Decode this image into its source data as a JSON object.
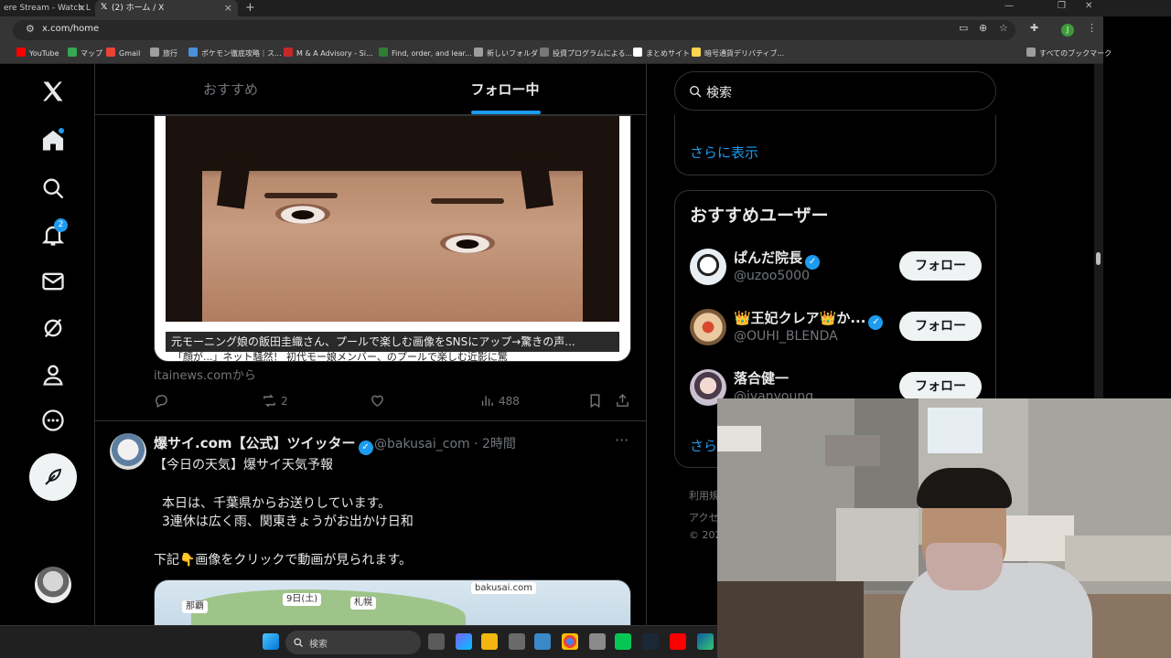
{
  "browser": {
    "tabs": [
      {
        "title": "ere Stream - Watch L"
      },
      {
        "title": "(2) ホーム / X"
      }
    ],
    "url": "x.com/home",
    "profile_initial": "J",
    "bookmarks": [
      {
        "label": "YouTube",
        "color": "#ff0000"
      },
      {
        "label": "マップ",
        "color": "#34a853"
      },
      {
        "label": "Gmail",
        "color": "#ea4335"
      },
      {
        "label": "旅行",
        "color": "#9e9e9e"
      },
      {
        "label": "ポケモン徹底攻略｜ス...",
        "color": "#4a90d9"
      },
      {
        "label": "M & A Advisory - Si...",
        "color": "#c62828"
      },
      {
        "label": "Find, order, and lear...",
        "color": "#2e7d32"
      },
      {
        "label": "新しいフォルダ",
        "color": "#9e9e9e"
      },
      {
        "label": "投資プログラムによる...",
        "color": "#777777"
      },
      {
        "label": "まとめサイト",
        "color": "#ffffff"
      },
      {
        "label": "暗号通貨デリバティブ...",
        "color": "#ffd54f"
      }
    ],
    "bookmarks_all": "すべてのブックマーク"
  },
  "nav": {
    "notifications_count": "2"
  },
  "timeline": {
    "tab_recommended": "おすすめ",
    "tab_following": "フォロー中",
    "card": {
      "caption": "元モーニング娘の飯田圭織さん、プールで楽しむ画像をSNSにアップ→驚きの声...",
      "caption2": "「顔が...」ネット騒然！ 初代モー娘メンバー、のプールで楽しむ近影に驚",
      "source": "itainews.comから"
    },
    "actions": {
      "reposts": "2",
      "views": "488"
    },
    "tweet2": {
      "name": "爆サイ.com【公式】ツイッター",
      "handle_time": "@bakusai_com · 2時間",
      "lines": [
        "【今日の天気】爆サイ天気予報",
        "",
        "本日は、千葉県からお送りしています。",
        "3連休は広く雨、関東きょうがお出かけ日和",
        "",
        "下記👇画像をクリックで動画が見られます。"
      ],
      "media": {
        "logo": "bakusai.com",
        "chip_date": "9日(土)",
        "chip_city1": "札幌",
        "chip_city2": "那覇"
      }
    }
  },
  "sidebar": {
    "search_placeholder": "検索",
    "trends_more": "さらに表示",
    "who_to_follow_title": "おすすめユーザー",
    "users": [
      {
        "name": "ぱんだ院長",
        "handle": "@uzoo5000",
        "verified": true,
        "follow": "フォロー"
      },
      {
        "name": "👑王妃クレア👑か...",
        "handle": "@OUHI_BLENDA",
        "verified": true,
        "follow": "フォロー"
      },
      {
        "name": "落合健一",
        "handle": "@jyanyoung",
        "verified": false,
        "follow": "フォロー"
      }
    ],
    "more": "さらに表示",
    "footer": [
      "利用規",
      "アクセ",
      "© 202"
    ]
  },
  "taskbar": {
    "search": "検索"
  },
  "colors": {
    "accent": "#1d9bf0",
    "bg": "#000000",
    "border": "#2f3336",
    "muted": "#71767b"
  }
}
